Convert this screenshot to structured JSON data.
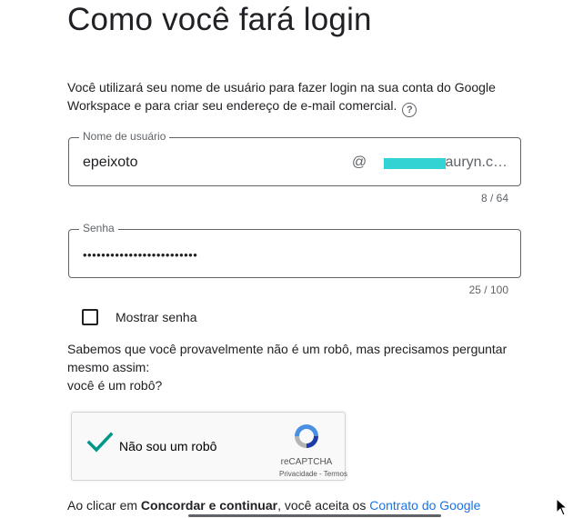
{
  "page": {
    "title": "Como você fará login",
    "description_line1": "Você utilizará seu nome de usuário para fazer login na sua conta do Google",
    "description_line2": "Workspace e para criar seu endereço de e-mail comercial."
  },
  "username": {
    "label": "Nome de usuário",
    "value": "epeixoto",
    "domain_prefix": "@",
    "domain_suffix": ".auryn.c…",
    "counter": "8 / 64"
  },
  "password": {
    "label": "Senha",
    "value": "•••••••••••••••••••••••••",
    "counter": "25 / 100"
  },
  "show_password": {
    "label": "Mostrar senha",
    "checked": false
  },
  "robot": {
    "line1": "Sabemos que você provavelmente não é um robô, mas precisamos perguntar",
    "line2": "mesmo assim:",
    "line3": "você é um robô?"
  },
  "recaptcha": {
    "label": "Não sou um robô",
    "brand": "reCAPTCHA",
    "privacy": "Privacidade",
    "separator": " - ",
    "terms": "Termos",
    "checked": true
  },
  "footer": {
    "prefix": "Ao clicar em ",
    "bold": "Concordar e continuar",
    "middle": ", você aceita os ",
    "link": "Contrato do Google"
  },
  "colors": {
    "accent_link": "#1a73e8",
    "check_green": "#009688",
    "redaction": "#33d3d3"
  }
}
